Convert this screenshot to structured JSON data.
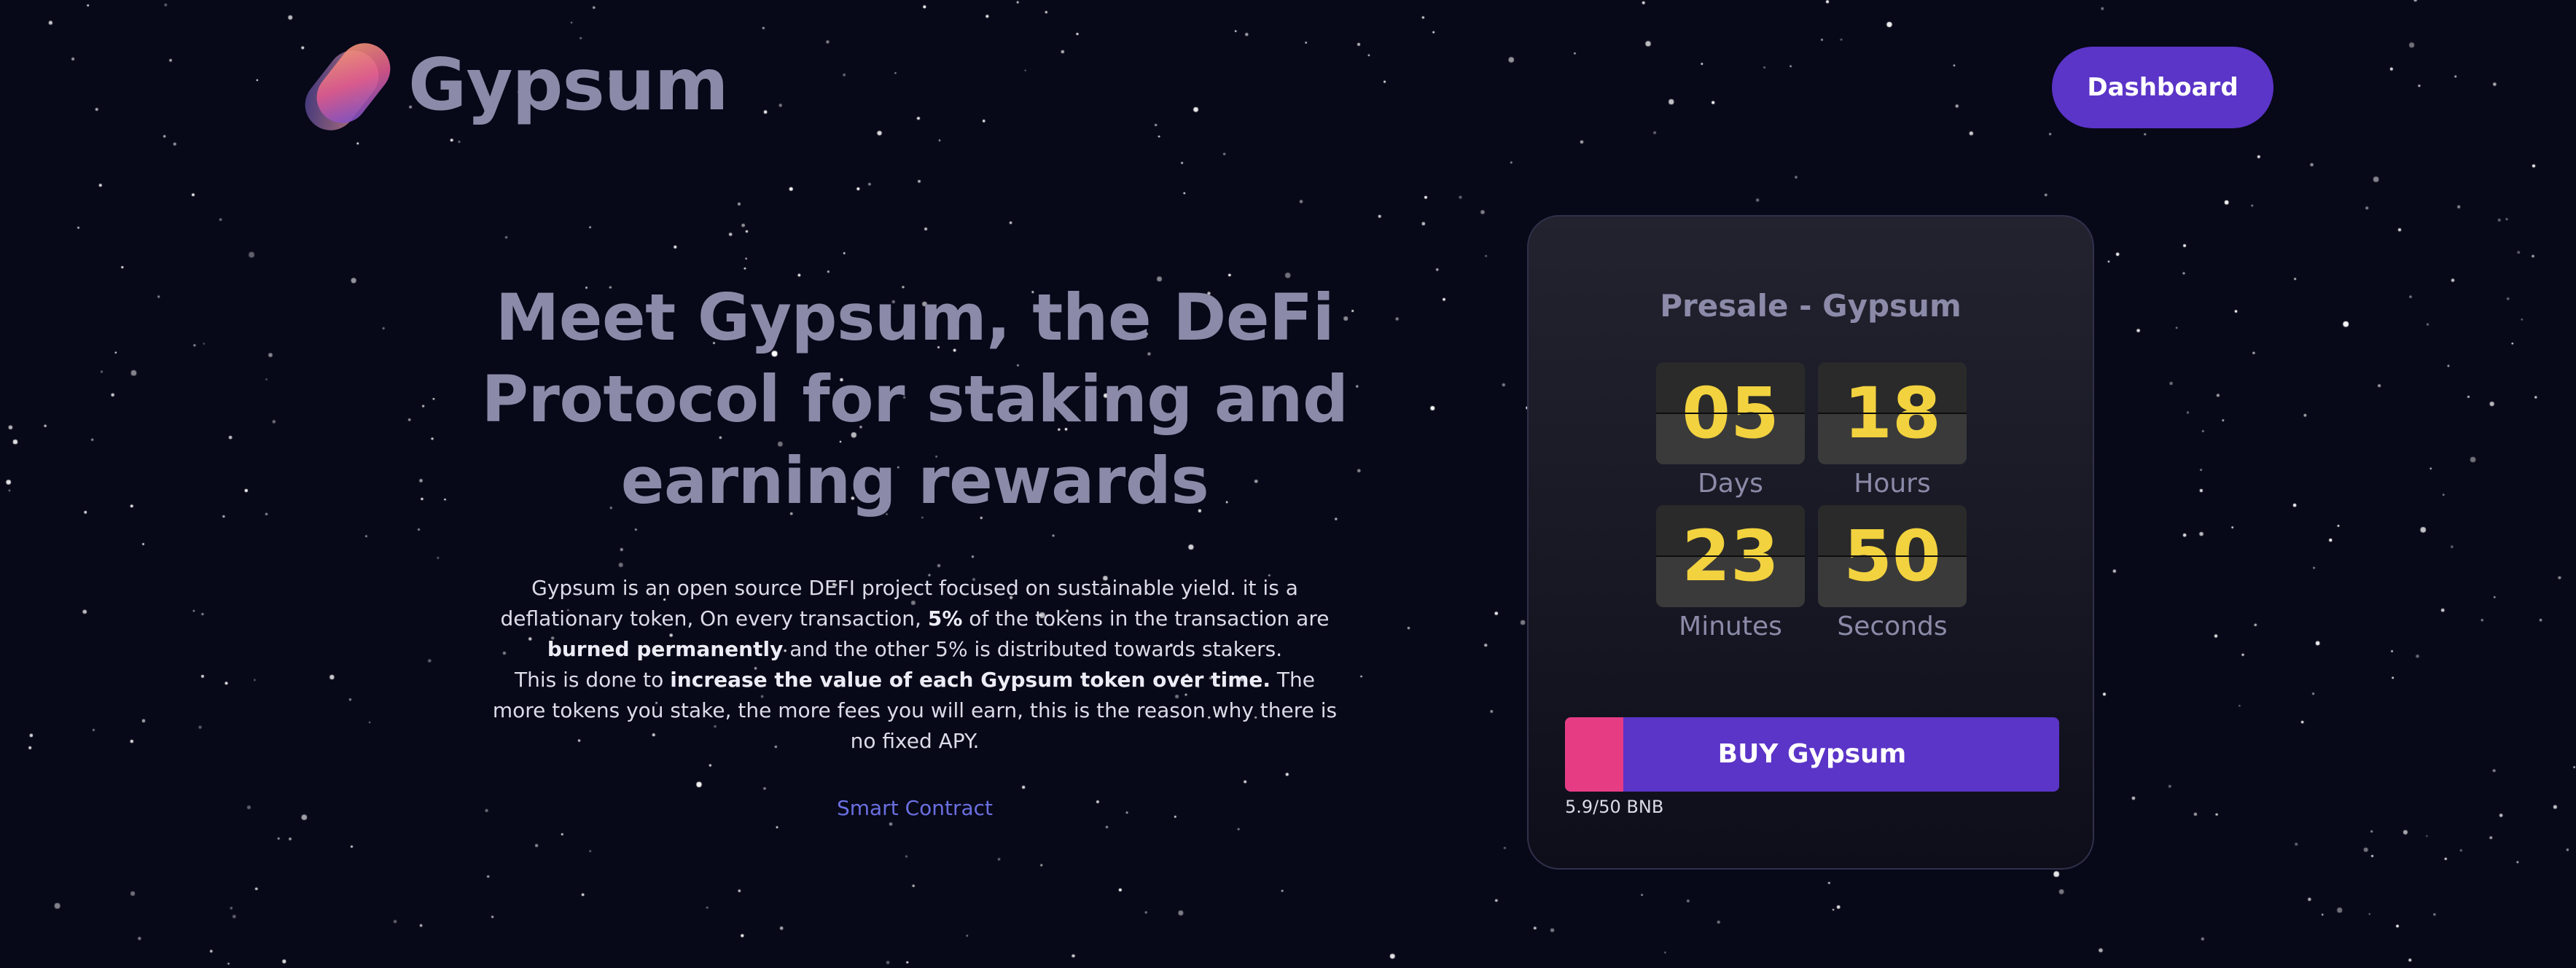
{
  "brand": {
    "name": "Gypsum",
    "logo_icon": "gypsum-logo-icon"
  },
  "nav": {
    "dashboard_label": "Dashboard"
  },
  "hero": {
    "title": "Meet Gypsum, the DeFi Protocol for staking and earning rewards",
    "description": {
      "s1": "Gypsum is an open source DEFI project focused on sustainable yield. it is a deflationary token, On every transaction, ",
      "s1_bold": "5%",
      "s2": " of the tokens in the transaction are ",
      "s2_bold": "burned permanently",
      "s3": " and the other 5% is distributed towards stakers.",
      "s4": "This is done to ",
      "s4_bold": "increase the value of each Gypsum token over time.",
      "s5": " The more tokens you stake, the more fees you will earn, this is the reason why there is no fixed APY."
    },
    "contract_link": "Smart Contract"
  },
  "presale": {
    "title": "Presale - Gypsum",
    "countdown": {
      "days": {
        "value": "05",
        "label": "Days"
      },
      "hours": {
        "value": "18",
        "label": "Hours"
      },
      "minutes": {
        "value": "23",
        "label": "Minutes"
      },
      "seconds": {
        "value": "50",
        "label": "Seconds"
      }
    },
    "buy_label": "BUY Gypsum",
    "raised_text": "5.9/50 BNB",
    "raised_value": 5.9,
    "raised_goal": 50
  },
  "colors": {
    "background": "#070818",
    "accent": "#5b34c8",
    "progress": "#e63c84",
    "countdown_digits": "#f2d23f",
    "muted_text": "#8b8aa8",
    "link": "#6a6fe0"
  }
}
